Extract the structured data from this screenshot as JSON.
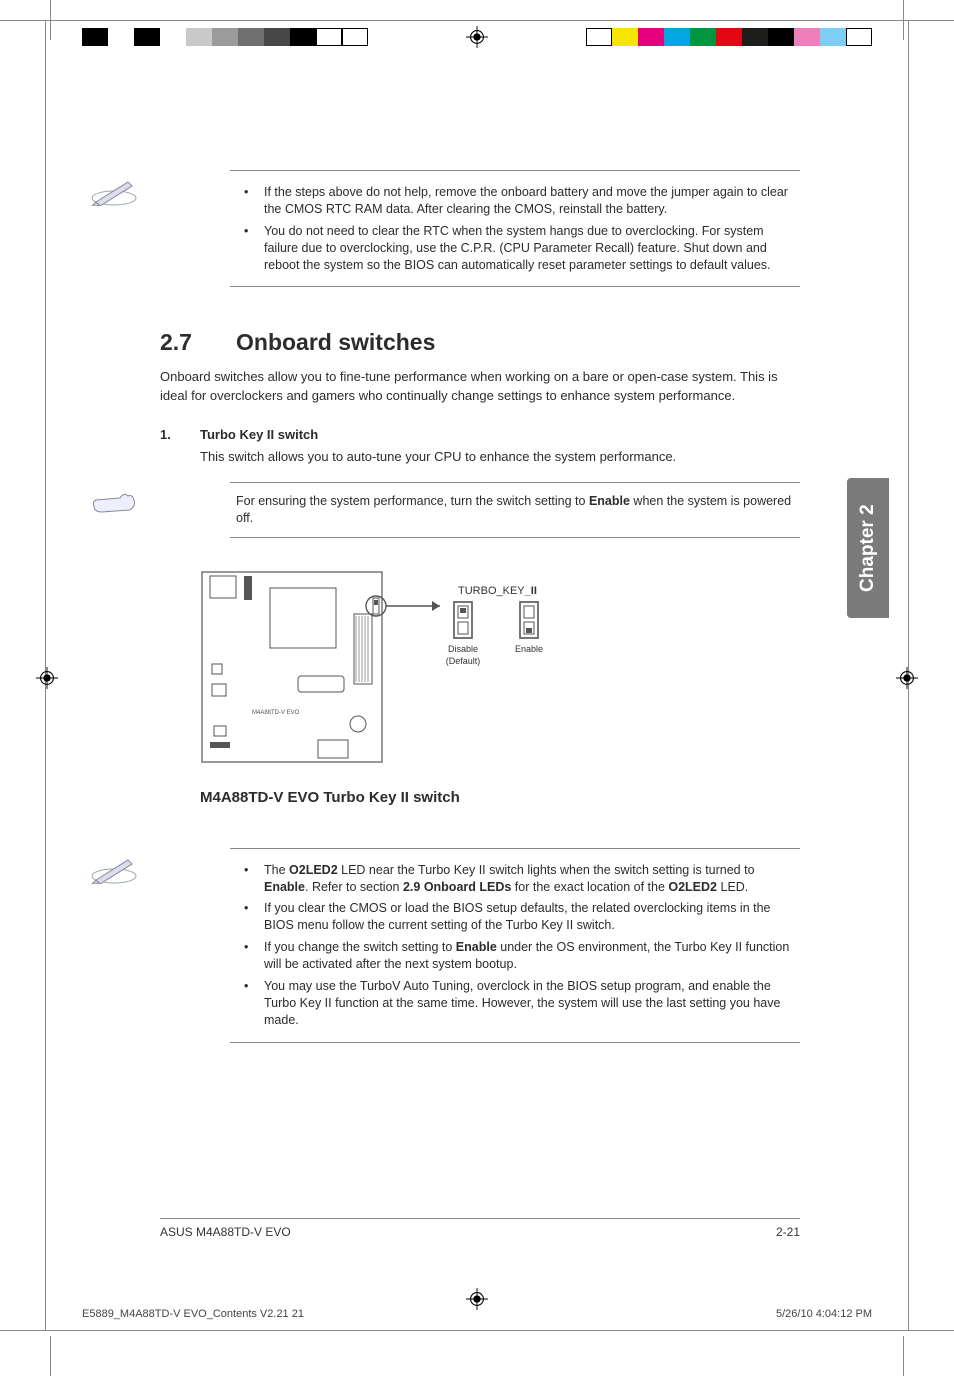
{
  "notes_top": [
    "If the steps above do not help, remove the onboard battery and move the jumper again to clear the CMOS RTC RAM data. After clearing the CMOS, reinstall the battery.",
    "You do not need to clear the RTC when the system hangs due to overclocking. For system failure due to overclocking, use the C.P.R. (CPU Parameter Recall) feature. Shut down and reboot the system so the BIOS can automatically reset parameter settings to default values."
  ],
  "section": {
    "number": "2.7",
    "title": "Onboard switches",
    "intro": "Onboard switches allow you to fine-tune performance when working on a bare or open-case system. This is ideal for overclockers and gamers who continually change settings to enhance system performance."
  },
  "item1": {
    "num": "1.",
    "title": "Turbo Key II switch",
    "desc": "This switch allows you to auto-tune your CPU to enhance the system performance."
  },
  "tip": {
    "pre": "For ensuring the system performance, turn the switch setting to ",
    "bold": "Enable",
    "post": " when the system is powered off."
  },
  "diagram": {
    "header": "TURBO_KEY_II",
    "left_label": "Disable",
    "left_sub": "(Default)",
    "right_label": "Enable",
    "board_label": "M4A88TD-V EVO",
    "caption": "M4A88TD-V EVO Turbo Key II switch"
  },
  "notes_bottom": [
    {
      "pre": "The ",
      "b1": "O2LED2",
      "mid": " LED near the Turbo Key II switch lights when the switch setting is turned to ",
      "b2": "Enable",
      "mid2": ". Refer to section ",
      "b3": "2.9 Onboard LEDs",
      "mid3": " for the exact location of the ",
      "b4": "O2LED2",
      "post": " LED."
    },
    {
      "text": "If you clear the CMOS or load the BIOS setup defaults, the related overclocking items in the BIOS menu follow the current setting of the Turbo Key II switch."
    },
    {
      "pre": "If you change the switch setting to ",
      "b1": "Enable",
      "post": " under the OS environment, the Turbo Key II function will be activated after the next system bootup."
    },
    {
      "text": "You may use the TurboV Auto Tuning, overclock in the BIOS setup program, and enable the Turbo Key II function at the same time. However, the system will use the last setting you have made."
    }
  ],
  "footer": {
    "left": "ASUS M4A88TD-V EVO",
    "right": "2-21"
  },
  "slug": {
    "left": "E5889_M4A88TD-V EVO_Contents V2.21   21",
    "right": "5/26/10   4:04:12 PM"
  },
  "chapter_tab": "Chapter 2",
  "colors": {
    "left_bar": [
      "#000",
      "#fff",
      "#000",
      "#fff",
      "#c9c9c9",
      "#9b9b9b",
      "#6f6f6f",
      "#474747",
      "#000",
      "#fff",
      "#fff"
    ],
    "right_bar": [
      "#fff",
      "#f6e600",
      "#e6007e",
      "#00a7e1",
      "#009640",
      "#e30613",
      "#1d1d1b",
      "#000",
      "#ef7fbb",
      "#7ecef4",
      "#fff"
    ]
  }
}
